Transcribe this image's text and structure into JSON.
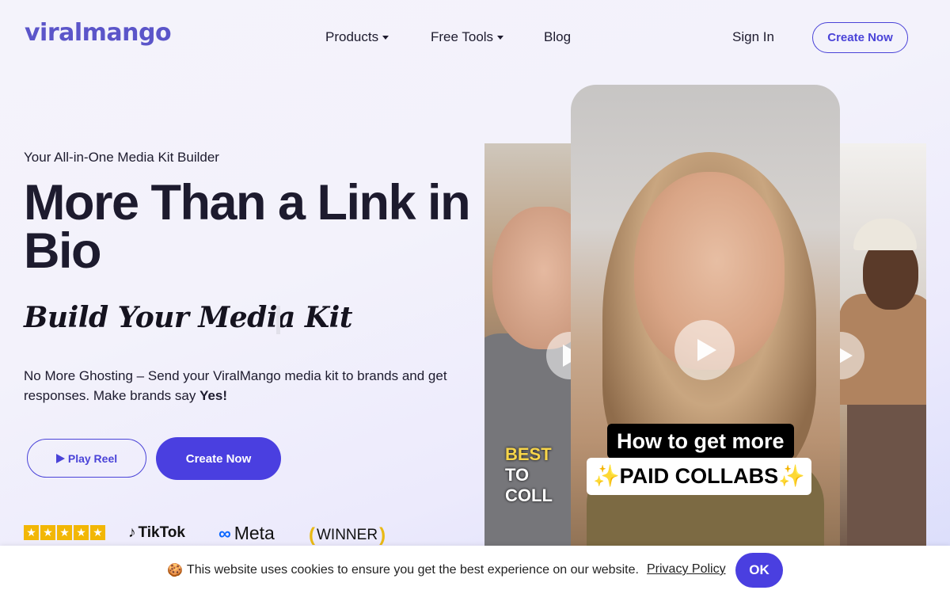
{
  "header": {
    "logo": "viralmango",
    "nav": [
      {
        "label": "Products"
      },
      {
        "label": "Free Tools"
      },
      {
        "label": "Blog"
      }
    ],
    "sign_in": "Sign In",
    "create_now": "Create Now"
  },
  "hero": {
    "eyebrow": "Your All-in-One Media Kit Builder",
    "headline": "More Than a Link in Bio",
    "subheadline": "Build Your Media Kit",
    "description_prefix": "No More Ghosting – Send your ViralMango media kit to brands and get responses. Make brands say ",
    "description_bold": "Yes!",
    "play_reel": "Play Reel",
    "create_now": "Create Now"
  },
  "badges": {
    "stars": [
      "★",
      "★",
      "★",
      "★",
      "★"
    ],
    "tiktok": "TikTok",
    "meta": "Meta",
    "winner": "WINNER"
  },
  "videos": {
    "left_caption_line1": "BEST",
    "left_caption_line2": "TO COLL",
    "main_caption_line1": "How to get more",
    "main_caption_line2": "✨PAID COLLABS✨"
  },
  "cookie": {
    "emoji": "🍪",
    "text": "This website uses cookies to ensure you get the best experience on our website.",
    "privacy_link": "Privacy Policy",
    "ok": "OK"
  },
  "colors": {
    "brand": "#4a3fe0",
    "logo": "#5b55c9",
    "text": "#1d1b2e"
  }
}
